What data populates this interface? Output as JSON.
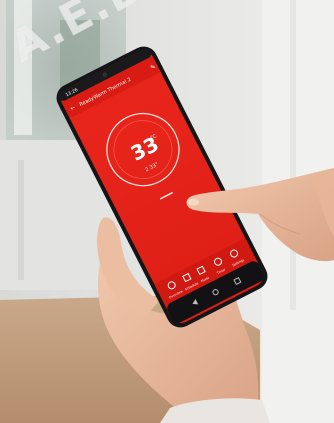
{
  "watermark": {
    "text": "A.E.B"
  },
  "phone": {
    "status_bar": {
      "time": "13:26"
    },
    "app": {
      "title": "ReadyWarm Thermal 2",
      "temperature": "33",
      "unit": "°C",
      "setpoint": "33°",
      "power_indicator": "2",
      "bottom_nav": [
        "Overview",
        "Schedule",
        "Mode",
        "Timer",
        "Settings"
      ],
      "accent_color": "#e8221b"
    }
  }
}
